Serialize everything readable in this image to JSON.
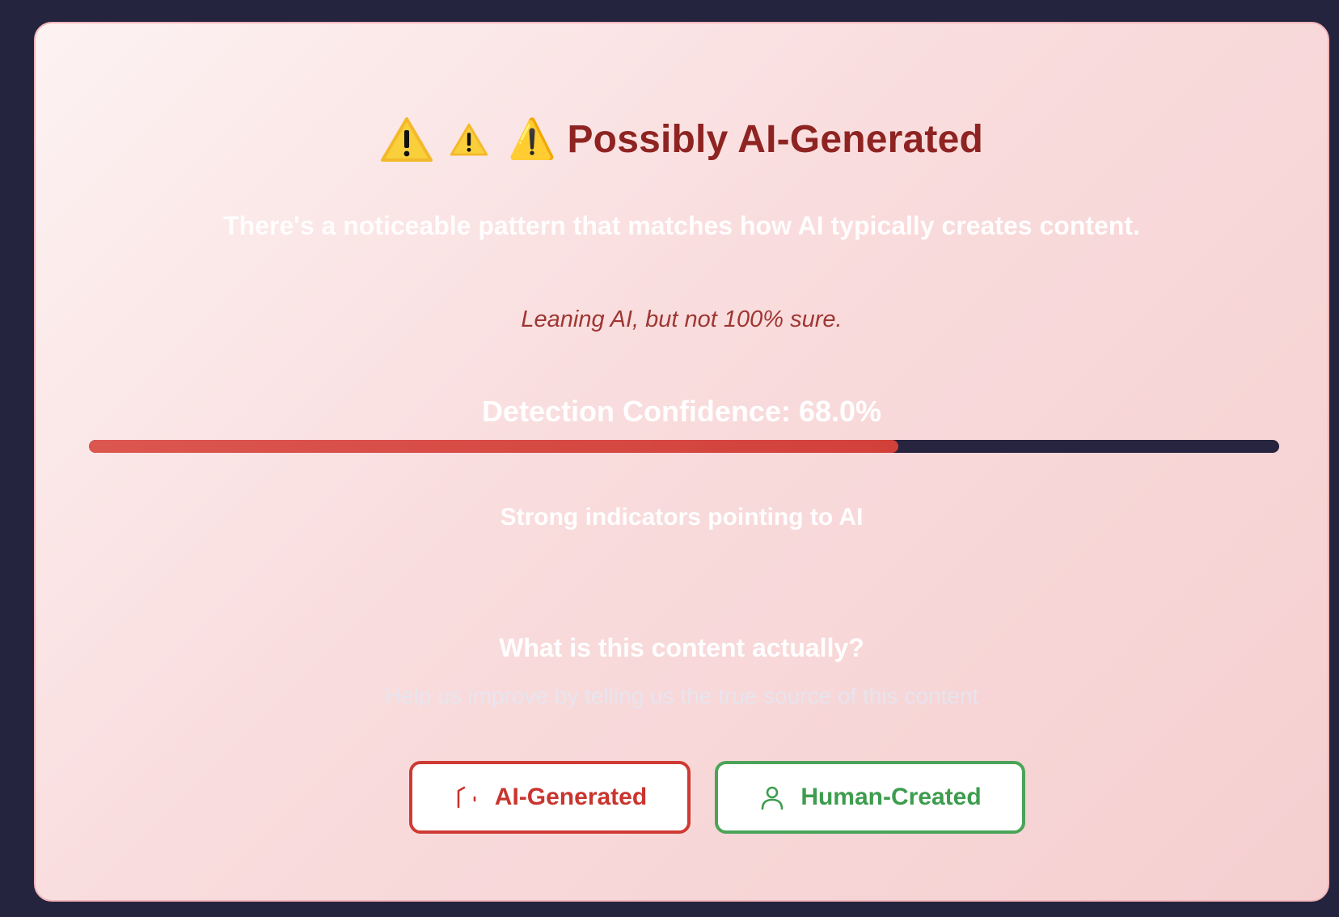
{
  "header": {
    "icon": "warning-icon",
    "title": "⚠️ Possibly AI-Generated"
  },
  "description": "There's a noticeable pattern that matches how AI typically creates content.",
  "note": "Leaning AI, but not 100% sure.",
  "confidence": {
    "label": "Detection Confidence: 68.0%",
    "value_percent": 68.0,
    "indicator": "Strong indicators pointing to AI"
  },
  "feedback": {
    "question": "What is this content actually?",
    "helper": "Help us improve by telling us the true source of this content",
    "ai_button": {
      "label": "AI-Generated",
      "icon": "bot-icon"
    },
    "human_button": {
      "label": "Human-Created",
      "icon": "user-icon"
    }
  },
  "colors": {
    "background": "#25243e",
    "accent_red": "#cf3a33",
    "accent_green": "#4aa457",
    "title": "#8e2422"
  }
}
